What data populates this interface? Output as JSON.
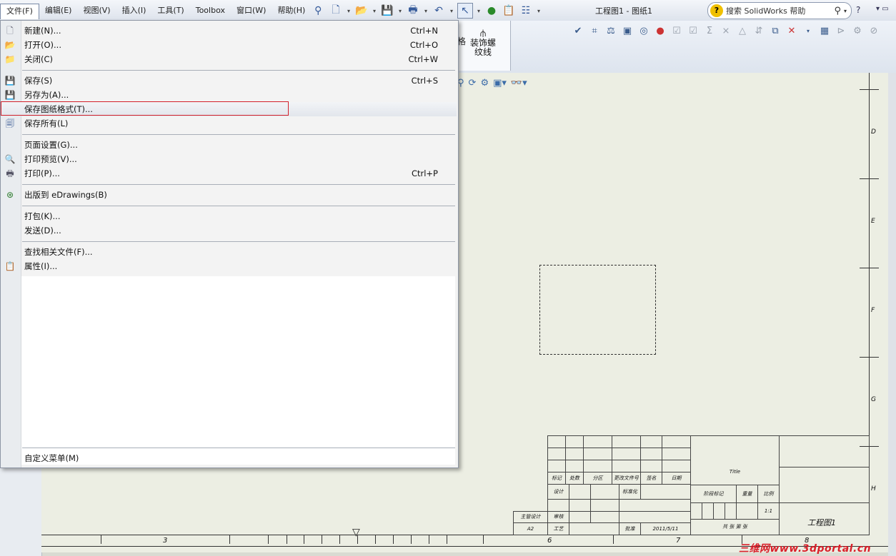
{
  "menubar": [
    "文件(F)",
    "编辑(E)",
    "视图(V)",
    "插入(I)",
    "工具(T)",
    "Toolbox",
    "窗口(W)",
    "帮助(H)"
  ],
  "title": "工程图1 - 图纸1",
  "search": {
    "placeholder": "搜索 SolidWorks 帮助"
  },
  "help_button": "?",
  "command_panel": {
    "partial_label": "格",
    "thread_label_line1": "装饰螺",
    "thread_label_line2": "纹线"
  },
  "file_menu": {
    "items": [
      {
        "label": "新建(N)...",
        "shortcut": "Ctrl+N",
        "icon": "new-document-icon",
        "glyph": "🗋"
      },
      {
        "label": "打开(O)...",
        "shortcut": "Ctrl+O",
        "icon": "open-folder-icon",
        "glyph": "📂"
      },
      {
        "label": "关闭(C)",
        "shortcut": "Ctrl+W",
        "icon": "close-folder-icon",
        "glyph": "📁"
      },
      {
        "label": "保存(S)",
        "shortcut": "Ctrl+S",
        "icon": "save-icon",
        "glyph": "💾"
      },
      {
        "label": "另存为(A)...",
        "shortcut": "",
        "icon": "save-as-icon",
        "glyph": "💾"
      },
      {
        "label": "保存图纸格式(T)...",
        "shortcut": "",
        "icon": "",
        "glyph": ""
      },
      {
        "label": "保存所有(L)",
        "shortcut": "",
        "icon": "save-all-icon",
        "glyph": "🗐"
      },
      {
        "label": "页面设置(G)...",
        "shortcut": "",
        "icon": "",
        "glyph": ""
      },
      {
        "label": "打印预览(V)...",
        "shortcut": "",
        "icon": "print-preview-icon",
        "glyph": "🔍"
      },
      {
        "label": "打印(P)...",
        "shortcut": "Ctrl+P",
        "icon": "print-icon",
        "glyph": "🖶"
      },
      {
        "label": "出版到 eDrawings(B)",
        "shortcut": "",
        "icon": "edrawings-icon",
        "glyph": "⊛"
      },
      {
        "label": "打包(K)...",
        "shortcut": "",
        "icon": "",
        "glyph": ""
      },
      {
        "label": "发送(D)...",
        "shortcut": "",
        "icon": "",
        "glyph": ""
      },
      {
        "label": "查找相关文件(F)...",
        "shortcut": "",
        "icon": "",
        "glyph": ""
      },
      {
        "label": "属性(I)...",
        "shortcut": "",
        "icon": "properties-icon",
        "glyph": "📋"
      }
    ],
    "customize": "自定义菜单(M)"
  },
  "sheet": {
    "zone_labels_right": [
      "D",
      "E",
      "F",
      "G",
      "H"
    ],
    "zone_labels_bottom": [
      "3",
      "6",
      "7",
      "8"
    ]
  },
  "title_block": {
    "row_labels": [
      "标记",
      "处数",
      "分区",
      "更改文件号",
      "签名",
      "日期"
    ],
    "design": "设计",
    "standard": "标准化",
    "stage_mark": "阶段标记",
    "weight": "重量",
    "scale": "比例",
    "scale_value": "1:1",
    "review": "审核",
    "process": "工艺",
    "approve": "批准",
    "sheet_count": "共 张 第 张",
    "mgr": "主管设计",
    "a2": "A2",
    "title_field": "Title",
    "date": "2011/5/11",
    "drawing_name": "工程图1"
  },
  "watermark": "三维网www.3dportal.cn"
}
